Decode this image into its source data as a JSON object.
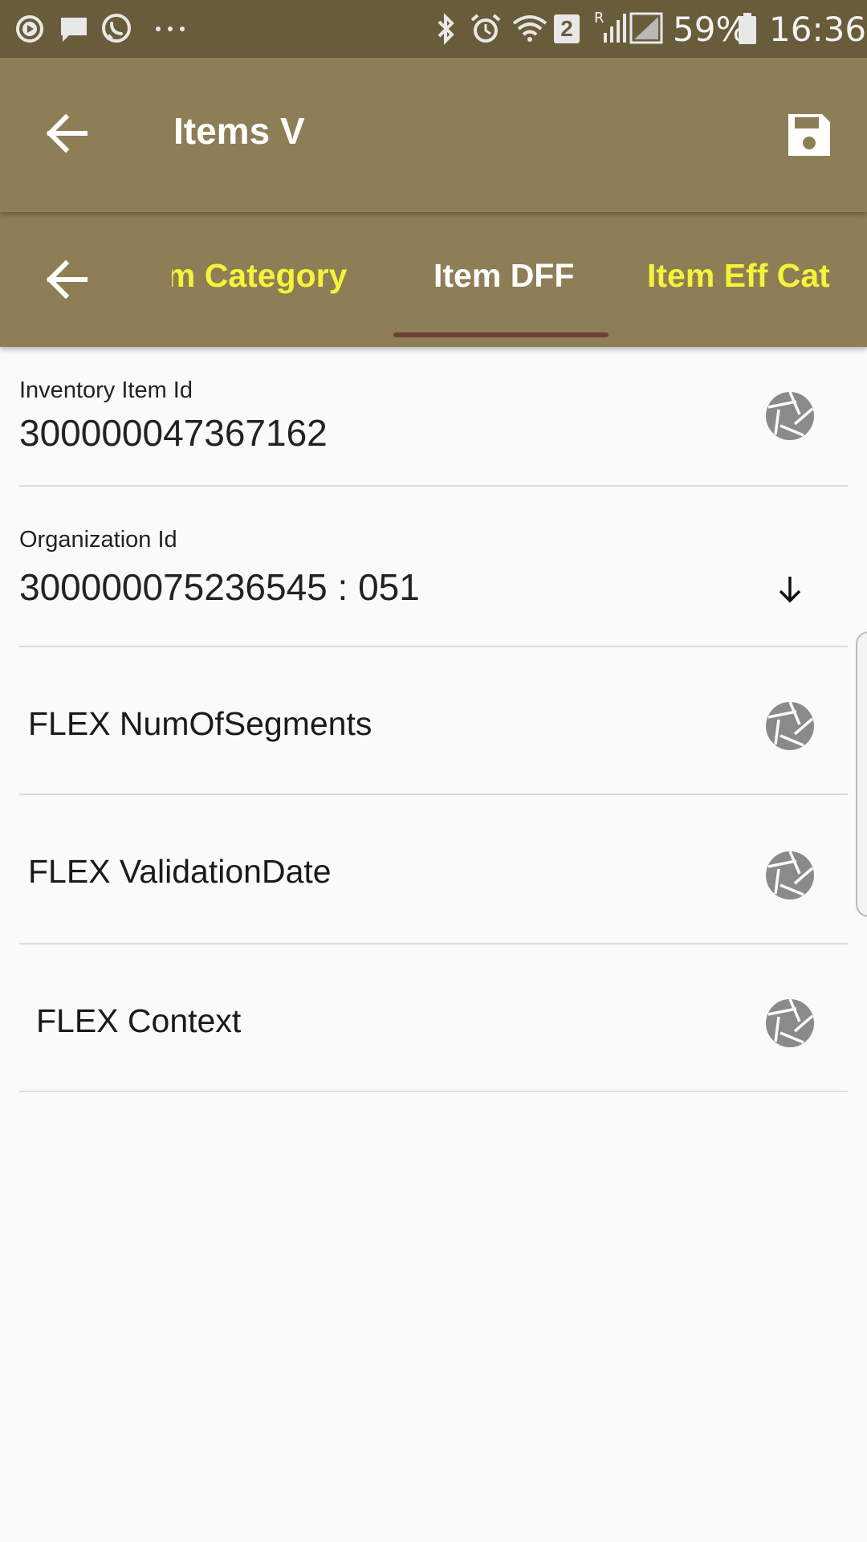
{
  "status_bar": {
    "battery": "59%",
    "time": "16:36",
    "sim_badge": "2",
    "roaming_indicator": "R",
    "left_icons": [
      "play-circle-icon",
      "chat-bubble-icon",
      "whatsapp-icon",
      "more-dots-icon"
    ],
    "right_icons": [
      "bluetooth-icon",
      "alarm-icon",
      "wifi-icon",
      "signal-icon",
      "battery-icon"
    ]
  },
  "app_bar": {
    "title": "Items V",
    "back_icon": "arrow-back-icon",
    "save_icon": "save-icon"
  },
  "tabs": {
    "back_icon": "arrow-back-icon",
    "items": [
      {
        "label": "Item Category",
        "active": false
      },
      {
        "label": "Item DFF",
        "active": true
      },
      {
        "label": "Item Eff Category",
        "active": false
      }
    ],
    "active_color": "#ffffff",
    "inactive_color": "#f4f43a",
    "indicator_color": "#6e3f39"
  },
  "form": {
    "inventory_item_id": {
      "label": "Inventory Item Id",
      "value": "300000047367162"
    },
    "organization_id": {
      "label": "Organization Id",
      "value": "300000075236545 : 051"
    },
    "flex_fields": [
      {
        "label": "FLEX NumOfSegments"
      },
      {
        "label": "FLEX ValidationDate"
      },
      {
        "label": "FLEX Context"
      }
    ]
  },
  "colors": {
    "status_bar": "#685c3b",
    "app_bar": "#8e7e56",
    "background": "#fafafa",
    "icon_gray": "#8a8a8a"
  }
}
